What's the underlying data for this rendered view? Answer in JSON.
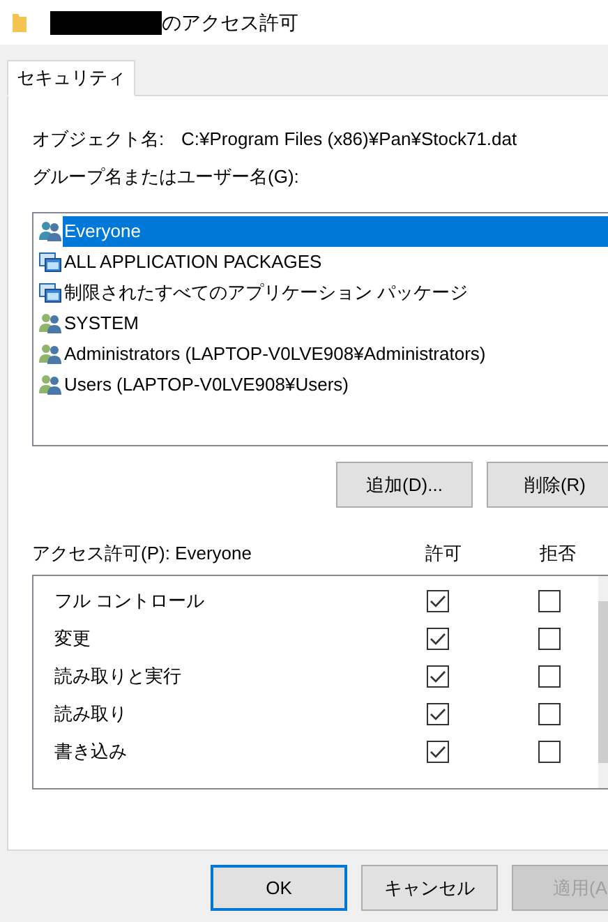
{
  "window": {
    "title": "のアクセス許可",
    "redacted": true
  },
  "tabs": [
    {
      "label": "セキュリティ",
      "selected": true
    }
  ],
  "object_name": {
    "label": "オブジェクト名:",
    "value": "C:¥Program Files (x86)¥Pan¥Stock71.dat"
  },
  "groups_label": "グループ名またはユーザー名(G):",
  "principals": [
    {
      "name": "Everyone",
      "kind": "group",
      "selected": true
    },
    {
      "name": "ALL APPLICATION PACKAGES",
      "kind": "package",
      "selected": false
    },
    {
      "name": "制限されたすべてのアプリケーション パッケージ",
      "kind": "package",
      "selected": false
    },
    {
      "name": "SYSTEM",
      "kind": "user",
      "selected": false
    },
    {
      "name": "Administrators (LAPTOP-V0LVE908¥Administrators)",
      "kind": "user",
      "selected": false
    },
    {
      "name": "Users (LAPTOP-V0LVE908¥Users)",
      "kind": "user",
      "selected": false
    }
  ],
  "principal_buttons": [
    "追加(D)...",
    "削除(R)"
  ],
  "permissions_header": {
    "label": "アクセス許可(P): Everyone",
    "allow": "許可",
    "deny": "拒否"
  },
  "permissions": [
    {
      "name": "フル コントロール",
      "allow": true,
      "deny": false
    },
    {
      "name": "変更",
      "allow": true,
      "deny": false
    },
    {
      "name": "読み取りと実行",
      "allow": true,
      "deny": false
    },
    {
      "name": "読み取り",
      "allow": true,
      "deny": false
    },
    {
      "name": "書き込み",
      "allow": true,
      "deny": false
    }
  ],
  "dialog_buttons": [
    {
      "label": "OK",
      "kind": "default",
      "disabled": false
    },
    {
      "label": "キャンセル",
      "kind": "normal",
      "disabled": false
    },
    {
      "label": "適用(A",
      "kind": "normal",
      "disabled": true
    }
  ]
}
